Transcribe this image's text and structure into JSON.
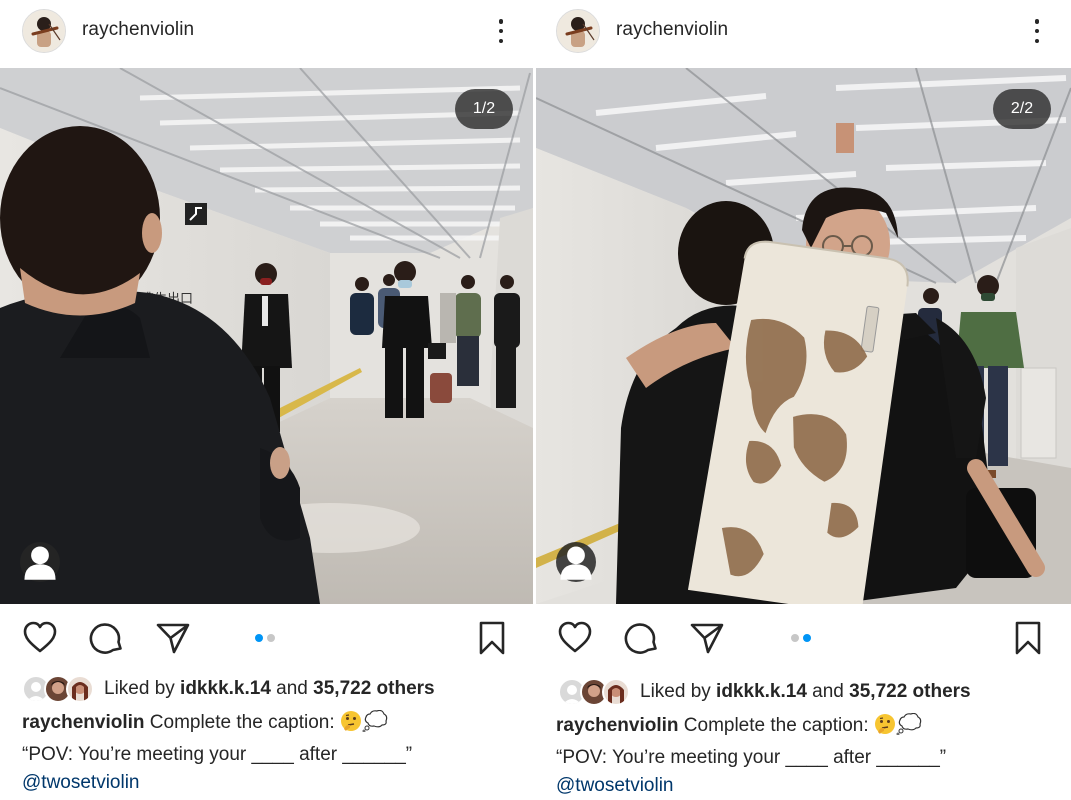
{
  "posts": [
    {
      "username": "raychenviolin",
      "counter": "1/2",
      "liked_prefix": "Liked by ",
      "liked_user": "idkkk.k.14",
      "liked_mid": " and ",
      "liked_count": "35,722 others",
      "caption_user": "raychenviolin",
      "caption_text": " Complete the caption: ",
      "caption_line2": "“POV: You’re meeting your ____ after ______”",
      "mention": "@twosetviolin",
      "active_slide": 1,
      "slide_count": 2,
      "photo_sign_text": "走逃生出口"
    },
    {
      "username": "raychenviolin",
      "counter": "2/2",
      "liked_prefix": "Liked by ",
      "liked_user": "idkkk.k.14",
      "liked_mid": " and ",
      "liked_count": "35,722 others",
      "caption_user": "raychenviolin",
      "caption_text": " Complete the caption: ",
      "caption_line2": "“POV: You’re meeting your ____ after ______”",
      "mention": "@twosetviolin",
      "active_slide": 2,
      "slide_count": 2
    }
  ],
  "icons": {
    "more": "more-vertical-icon",
    "like": "heart-icon",
    "comment": "comment-bubble-icon",
    "share": "paper-plane-icon",
    "save": "bookmark-icon",
    "tag": "person-tag-icon",
    "emoji_1": "thinking-face-emoji",
    "emoji_2": "thought-balloon-emoji"
  },
  "colors": {
    "text": "#262626",
    "link": "#00376b",
    "active_dot": "#0095f6",
    "inactive_dot": "#c7c7c7",
    "overlay": "#262626"
  }
}
